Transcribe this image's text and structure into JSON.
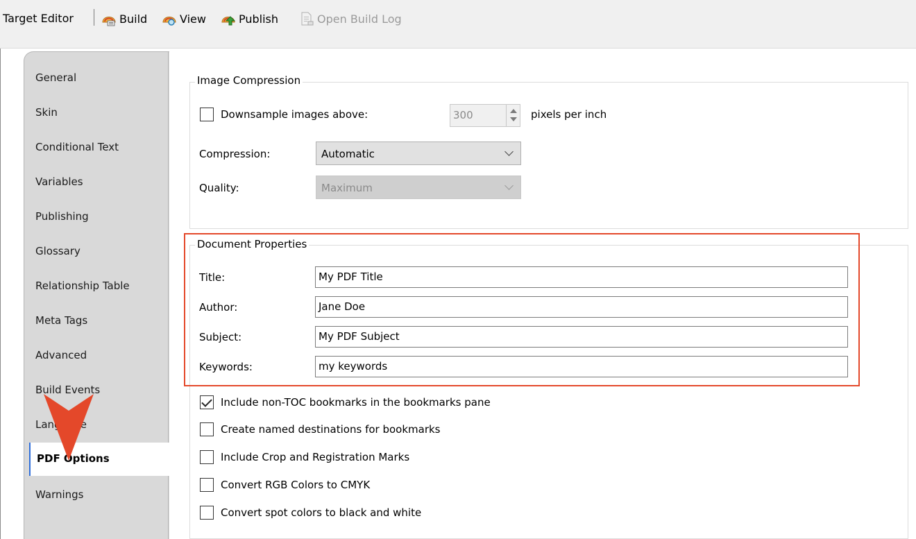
{
  "toolbar": {
    "title": "Target Editor",
    "build_label": "Build",
    "view_label": "View",
    "publish_label": "Publish",
    "open_log_label": "Open Build Log"
  },
  "tabs": [
    {
      "label": "General"
    },
    {
      "label": "Skin"
    },
    {
      "label": "Conditional Text"
    },
    {
      "label": "Variables"
    },
    {
      "label": "Publishing"
    },
    {
      "label": "Glossary"
    },
    {
      "label": "Relationship Table"
    },
    {
      "label": "Meta Tags"
    },
    {
      "label": "Advanced"
    },
    {
      "label": "Build Events"
    },
    {
      "label": "Language"
    },
    {
      "label": "PDF Options",
      "active": true
    },
    {
      "label": "Warnings"
    }
  ],
  "image_compression": {
    "group_title": "Image Compression",
    "downsample_label": "Downsample images above:",
    "downsample_checked": false,
    "dpi_value": "300",
    "dpi_unit": "pixels per inch",
    "compression_label": "Compression:",
    "compression_value": "Automatic",
    "quality_label": "Quality:",
    "quality_value": "Maximum"
  },
  "document_properties": {
    "group_title": "Document Properties",
    "title_label": "Title:",
    "title_value": "My PDF Title",
    "author_label": "Author:",
    "author_value": "Jane Doe",
    "subject_label": "Subject:",
    "subject_value": "My PDF Subject",
    "keywords_label": "Keywords:",
    "keywords_value": "my keywords"
  },
  "options": [
    {
      "label": "Include non-TOC bookmarks in the bookmarks pane",
      "checked": true
    },
    {
      "label": "Create named destinations for bookmarks",
      "checked": false
    },
    {
      "label": "Include Crop and Registration Marks",
      "checked": false
    },
    {
      "label": "Convert RGB Colors to CMYK",
      "checked": false
    },
    {
      "label": "Convert spot colors to black and white",
      "checked": false
    }
  ],
  "colors": {
    "highlight": "#e4482a",
    "pointer": "#e4482a",
    "active_tab_accent": "#2f6fdb"
  }
}
